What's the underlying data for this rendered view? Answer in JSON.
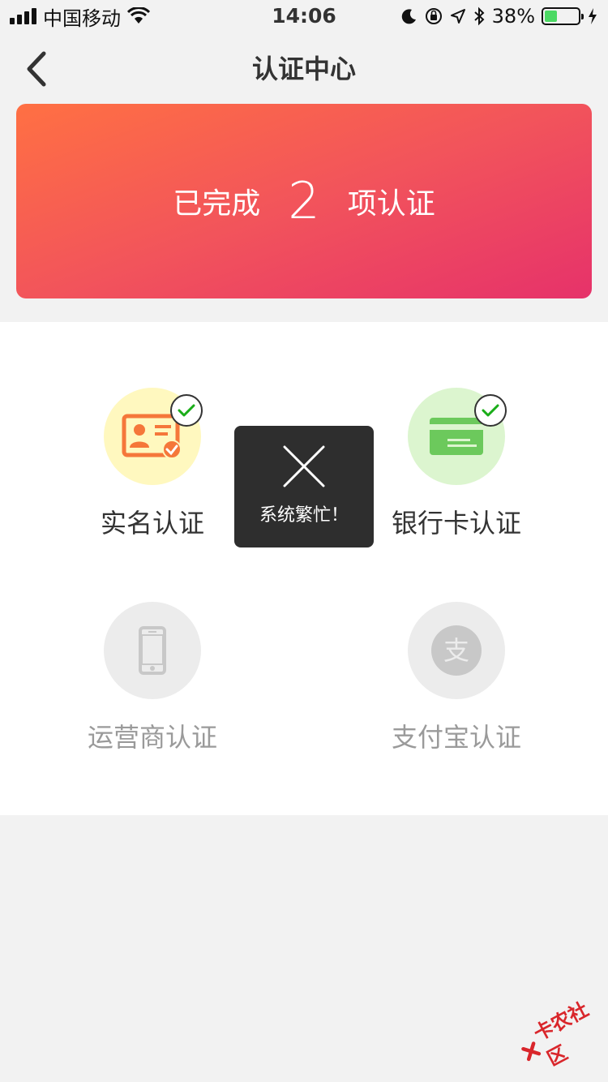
{
  "status_bar": {
    "carrier": "中国移动",
    "time": "14:06",
    "battery_percent": "38%",
    "battery_level": 0.38
  },
  "nav": {
    "title": "认证中心"
  },
  "banner": {
    "prefix": "已完成",
    "count": "2",
    "suffix": "项认证"
  },
  "items": [
    {
      "label": "实名认证",
      "status": "completed",
      "icon": "id-card-icon"
    },
    {
      "label": "银行卡认证",
      "status": "completed",
      "icon": "bank-card-icon"
    },
    {
      "label": "运营商认证",
      "status": "pending",
      "icon": "phone-icon"
    },
    {
      "label": "支付宝认证",
      "status": "pending",
      "icon": "alipay-icon"
    }
  ],
  "alipay_glyph": "支",
  "toast": {
    "message": "系统繁忙！"
  },
  "watermark": {
    "text": "卡农社区"
  },
  "colors": {
    "banner_start": "#ff7043",
    "banner_end": "#e6326a",
    "check_green": "#1aad19",
    "id_orange": "#f5773a",
    "bank_green": "#6cc95c"
  }
}
